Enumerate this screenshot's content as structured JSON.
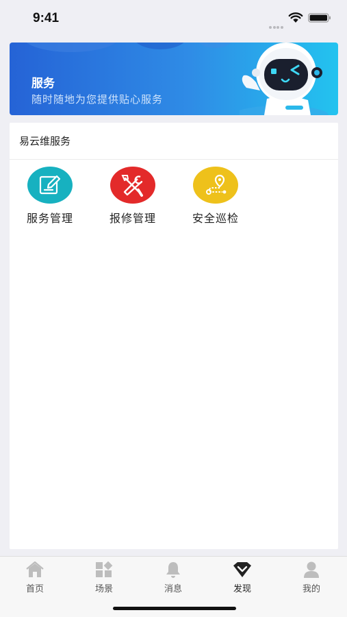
{
  "status_bar": {
    "time": "9:41",
    "icons": [
      "signal-dots-icon",
      "wifi-icon",
      "battery-icon"
    ]
  },
  "banner": {
    "title": "服务",
    "subtitle": "随时随地为您提供贴心服务",
    "image": "robot-mascot-icon",
    "colors": {
      "gradient_start": "#2563d6",
      "gradient_end": "#23c3ef"
    }
  },
  "service_section": {
    "title": "易云维服务",
    "items": [
      {
        "label": "服务管理",
        "icon": "edit-icon",
        "color": "#17b1c0"
      },
      {
        "label": "报修管理",
        "icon": "tools-icon",
        "color": "#e32a2a"
      },
      {
        "label": "安全巡检",
        "icon": "route-pin-icon",
        "color": "#eec11b"
      }
    ]
  },
  "tab_bar": {
    "active": "发现",
    "items": [
      {
        "label": "首页",
        "icon": "home-icon"
      },
      {
        "label": "场景",
        "icon": "grid-icon"
      },
      {
        "label": "消息",
        "icon": "bell-icon"
      },
      {
        "label": "发现",
        "icon": "diamond-icon"
      },
      {
        "label": "我的",
        "icon": "person-icon"
      }
    ],
    "colors": {
      "inactive_icon": "#bdbdbd",
      "active_icon": "#222222"
    }
  }
}
